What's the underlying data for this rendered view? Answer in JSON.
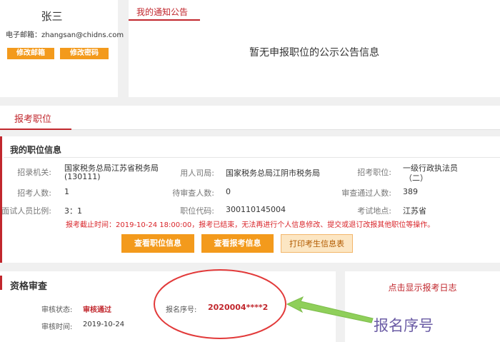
{
  "profile": {
    "name": "张三",
    "email_label": "电子邮箱：",
    "email": "zhangsan@chidns.com",
    "edit_email": "修改邮箱",
    "edit_password": "修改密码"
  },
  "notice": {
    "tab": "我的通知公告",
    "empty": "暂无申报职位的公示公告信息"
  },
  "tab": {
    "label": "报考职位"
  },
  "position": {
    "title": "我的职位信息",
    "row1": {
      "org_label": "招录机关:",
      "org_line1": "国家税务总局江苏省税务局",
      "org_line2": "(130111)",
      "unit_label": "用人司局:",
      "unit": "国家税务总局江阴市税务局",
      "job_label": "招考职位:",
      "job_line1": "一级行政执法员",
      "job_line2": "（二）"
    },
    "row2": {
      "count_label": "招考人数:",
      "count": "1",
      "pending_label": "待审查人数:",
      "pending": "0",
      "passed_label": "审查通过人数:",
      "passed": "389"
    },
    "row3": {
      "ratio_label": "面试人员比例:",
      "ratio": "3：1",
      "code_label": "职位代码:",
      "code": "300110145004",
      "site_label": "考试地点:",
      "site": "江苏省"
    },
    "deadline": "报考截止时间：2019-10-24 18:00:00，报考已结束，无法再进行个人信息修改、提交或退订改报其他职位等操作。",
    "btn_view_position": "查看职位信息",
    "btn_view_registration": "查看报考信息",
    "btn_print": "打印考生信息表"
  },
  "qualification": {
    "title": "资格审查",
    "status_label": "审核状态:",
    "status": "审核通过",
    "time_label": "审核时间:",
    "time": "2019-10-24",
    "regno_label": "报名序号:",
    "regno": "2020004****2"
  },
  "log": {
    "link": "点击显示报考日志"
  },
  "annotation": {
    "text": "报名序号",
    "circle_color": "#e23a3a",
    "arrow_color": "#8fcf5a"
  }
}
